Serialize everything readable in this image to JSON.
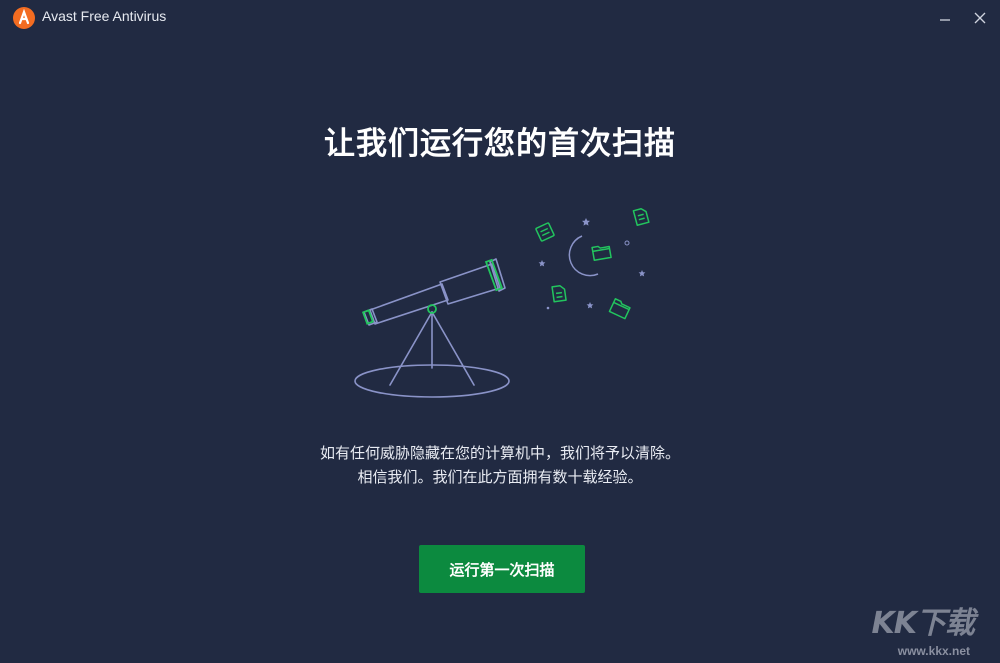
{
  "window": {
    "title": "Avast Free Antivirus",
    "logo_icon": "avast-logo-icon",
    "minimize_icon": "minimize-icon",
    "close_icon": "close-icon"
  },
  "main": {
    "heading": "让我们运行您的首次扫描",
    "description_lines": [
      "如有任何威胁隐藏在您的计算机中，我们将予以清除。",
      "相信我们。我们在此方面拥有数十载经验。"
    ],
    "primary_button": "运行第一次扫描",
    "illustration_icon": "telescope-icon"
  },
  "watermark": {
    "logo_text": "KK下载",
    "url": "www.kkx.net"
  },
  "colors": {
    "background": "#212a42",
    "accent_green": "#0c8a3f",
    "icon_green": "#22c55e",
    "line_art": "#8a93c8",
    "brand_orange": "#f36c21"
  }
}
